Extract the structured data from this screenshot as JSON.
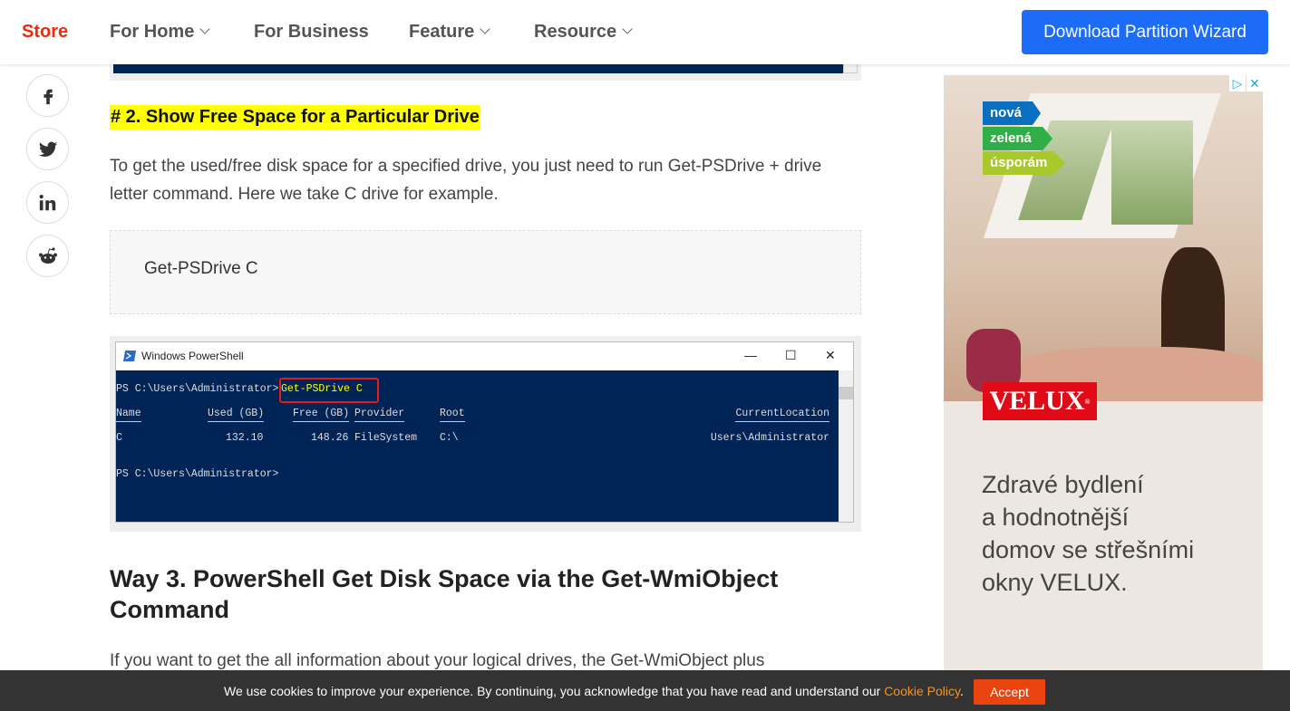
{
  "nav": {
    "store": "Store",
    "for_home": "For Home",
    "for_business": "For Business",
    "feature": "Feature",
    "resource": "Resource",
    "download": "Download Partition Wizard"
  },
  "share": [
    "facebook-icon",
    "twitter-icon",
    "linkedin-icon",
    "reddit-icon"
  ],
  "article": {
    "heading2": "# 2. Show Free Space for a Particular Drive",
    "para1": "To get the used/free disk space for a specified drive, you just need to run Get-PSDrive + drive letter command. Here we take C drive for example.",
    "code": "Get-PSDrive C",
    "powershell": {
      "title": "Windows PowerShell",
      "prompt": "PS C:\\Users\\Administrator>",
      "command": "Get-PSDrive C",
      "headers": [
        "Name",
        "Used (GB)",
        "Free (GB)",
        "Provider",
        "Root",
        "CurrentLocation"
      ],
      "row": [
        "C",
        "132.10",
        "148.26",
        "FileSystem",
        "C:\\",
        "Users\\Administrator"
      ],
      "prompt2": "PS C:\\Users\\Administrator>"
    },
    "way3": "Way 3. PowerShell Get Disk Space via the Get-WmiObject Command",
    "para2": "If you want to get the all information about your logical drives, the Get-WmiObject plus"
  },
  "ad": {
    "tags": [
      "nová",
      "zelená",
      "úsporám"
    ],
    "brand": "VELUX",
    "slogan": "Zdravé bydlení\na hodnotnější\ndomov se střešními\nokny VELUX."
  },
  "cookie": {
    "text": "We use cookies to improve your experience. By continuing, you acknowledge that you have read and understand our ",
    "link": "Cookie Policy",
    "end": ".",
    "accept": "Accept"
  },
  "colors": {
    "accent": "#1d6cf7",
    "store": "#f5260c",
    "terminal": "#012456",
    "accept": "#e9430f"
  }
}
